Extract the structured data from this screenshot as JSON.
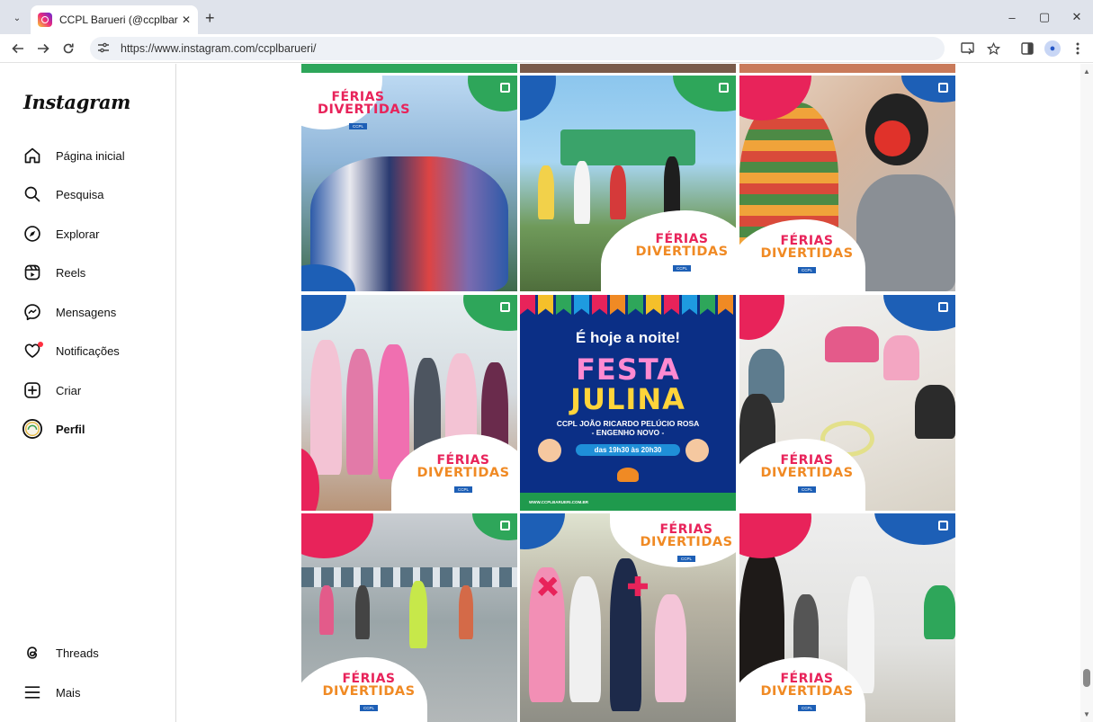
{
  "browser": {
    "tab_title": "CCPL Barueri (@ccplbarueri) • F",
    "url": "https://www.instagram.com/ccplbarueri/",
    "new_tab": "+",
    "tab_close": "✕",
    "menu_glyph": "⌄",
    "minimize": "–",
    "maximize": "▢",
    "close": "✕",
    "profile_initial": "●"
  },
  "sidebar": {
    "logo": "Instagram",
    "items": [
      {
        "label": "Página inicial",
        "icon": "home-icon"
      },
      {
        "label": "Pesquisa",
        "icon": "search-icon"
      },
      {
        "label": "Explorar",
        "icon": "compass-icon"
      },
      {
        "label": "Reels",
        "icon": "reels-icon"
      },
      {
        "label": "Mensagens",
        "icon": "messenger-icon"
      },
      {
        "label": "Notificações",
        "icon": "heart-icon"
      },
      {
        "label": "Criar",
        "icon": "create-icon"
      },
      {
        "label": "Perfil",
        "icon": "profile-avatar"
      }
    ],
    "bottom_items": [
      {
        "label": "Threads",
        "icon": "threads-icon"
      },
      {
        "label": "Mais",
        "icon": "menu-icon"
      }
    ]
  },
  "posts": {
    "ferias": {
      "line1": "FÉRIAS",
      "line2": "DIVERTIDAS"
    },
    "festa": {
      "headline": "É hoje a noite!",
      "title1": "FESTA",
      "title2": "JULINA",
      "venue": "CCPL JOÃO RICARDO PELÚCIO ROSA",
      "district": "- ENGENHO NOVO -",
      "time": "das 19h30 às 20h30",
      "footer": "WWW.CCPLBARUERI.COM.BR"
    }
  },
  "colors": {
    "pink": "#e8235a",
    "green": "#2ea65a",
    "blue": "#1d5fb6",
    "orange": "#f08a24",
    "festa_bg": "#0b2f86"
  }
}
